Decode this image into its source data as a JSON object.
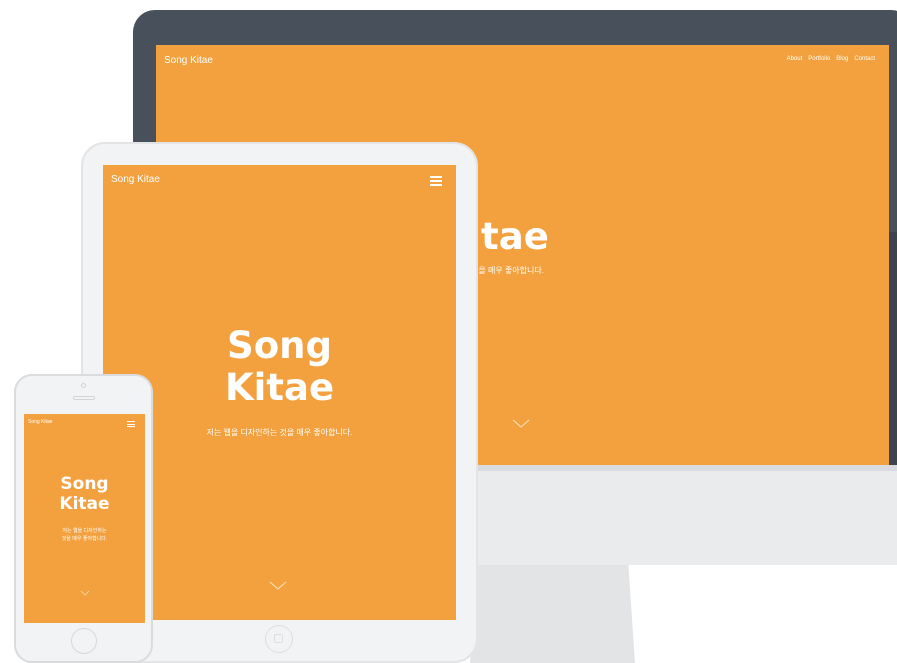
{
  "desktop": {
    "brand": "Song Kitae",
    "nav": [
      "About",
      "Portfolio",
      "Blog",
      "Contact"
    ],
    "hero_title": "ng Kitae",
    "hero_subtitle": "디자인하는 것을 매우 좋아합니다."
  },
  "tablet": {
    "brand": "Song Kitae",
    "hero_title_line1": "Song",
    "hero_title_line2": "Kitae",
    "hero_subtitle": "저는 웹을 디자인하는 것을 매우 좋아합니다."
  },
  "phone": {
    "brand": "Song Kitae",
    "hero_title_line1": "Song",
    "hero_title_line2": "Kitae",
    "hero_subtitle_line1": "저는 웹을 디자인하는",
    "hero_subtitle_line2": "것을 매우 좋아합니다."
  },
  "colors": {
    "accent": "#f3a13e",
    "monitor_bezel": "#48505b",
    "device_frame": "#f2f3f4"
  },
  "icons": [
    "hamburger-menu-icon",
    "chevron-down-icon",
    "home-button-icon",
    "camera-icon",
    "speaker-icon"
  ]
}
